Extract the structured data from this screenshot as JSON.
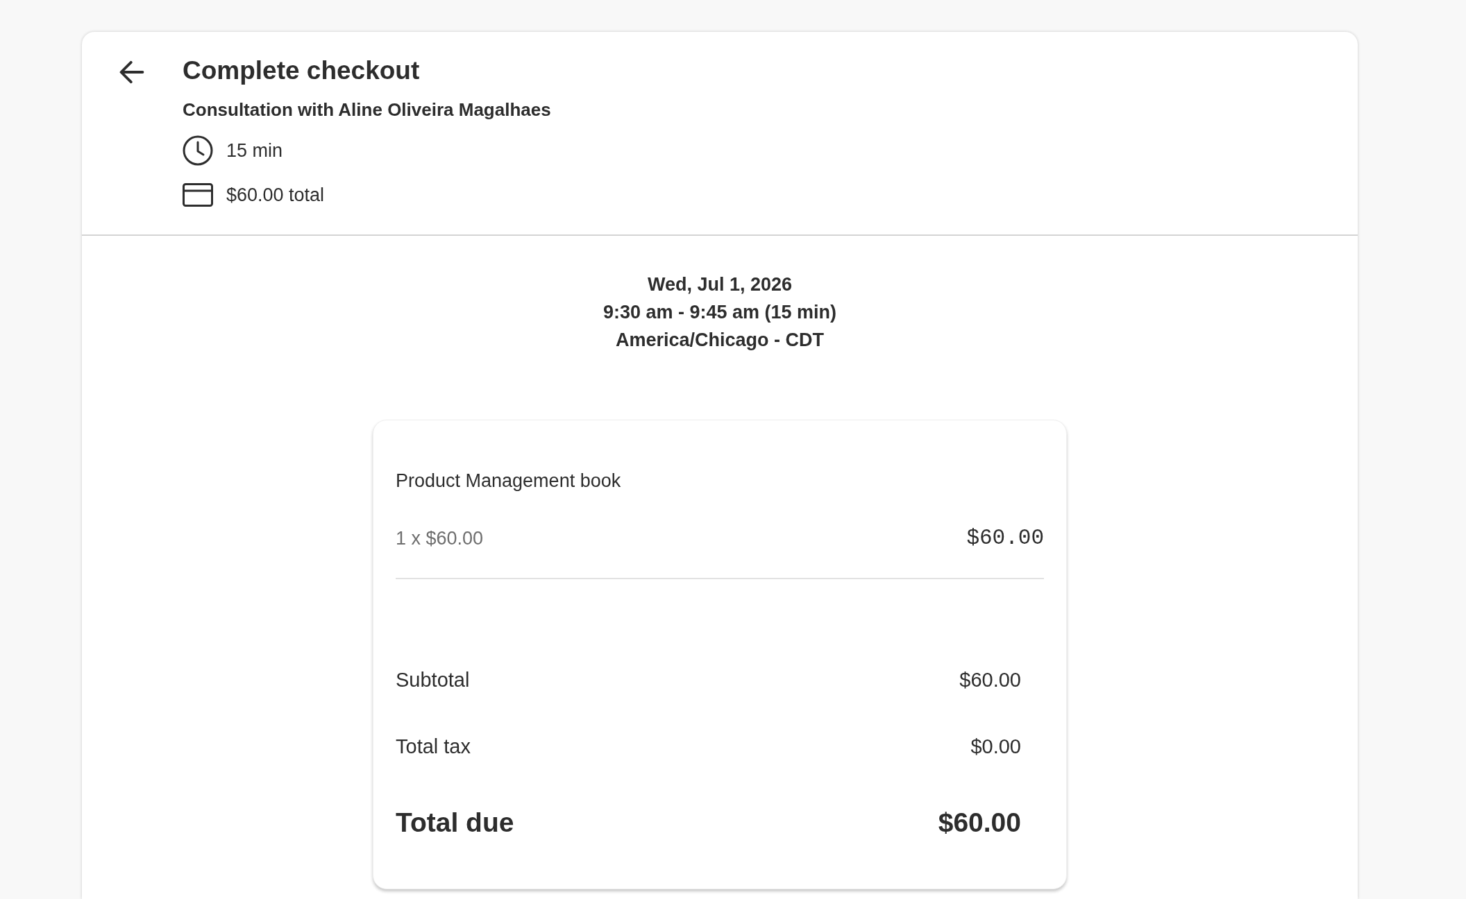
{
  "header": {
    "title": "Complete checkout",
    "subtitle": "Consultation with Aline Oliveira Magalhaes",
    "details": [
      {
        "kind": "duration",
        "text": "15 min"
      },
      {
        "kind": "price",
        "text": "$60.00 total"
      }
    ]
  },
  "schedule": {
    "date": "Wed, Jul 1, 2026",
    "time": "9:30 am - 9:45 am (15 min)",
    "timezone": "America/Chicago - CDT"
  },
  "order": {
    "items": [
      {
        "name": "Product Management book",
        "quantity_price": "1 x $60.00",
        "amount": "$60.00"
      }
    ],
    "summary": [
      {
        "kind": "line",
        "label": "Subtotal",
        "value": "$60.00"
      },
      {
        "kind": "line",
        "label": "Total tax",
        "value": "$0.00"
      },
      {
        "kind": "total",
        "label": "Total due",
        "value": "$60.00"
      }
    ]
  }
}
